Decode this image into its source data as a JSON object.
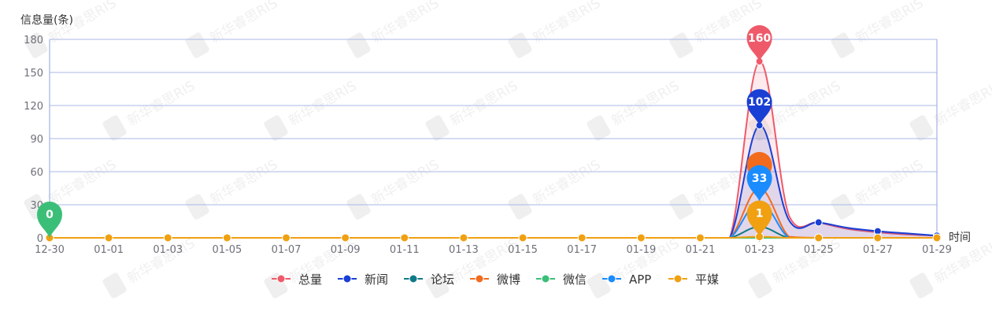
{
  "chart_data": {
    "type": "line",
    "ylabel": "信息量(条)",
    "xlabel": "时间",
    "ylim": [
      0,
      180
    ],
    "yticks": [
      0,
      30,
      60,
      90,
      120,
      150,
      180
    ],
    "categories": [
      "12-30",
      "12-31",
      "01-01",
      "01-02",
      "01-03",
      "01-04",
      "01-05",
      "01-06",
      "01-07",
      "01-08",
      "01-09",
      "01-10",
      "01-11",
      "01-12",
      "01-13",
      "01-14",
      "01-15",
      "01-16",
      "01-17",
      "01-18",
      "01-19",
      "01-20",
      "01-21",
      "01-22",
      "01-23",
      "01-24",
      "01-25",
      "01-26",
      "01-27",
      "01-28",
      "01-29"
    ],
    "x_tick_labels": [
      "12-30",
      "01-01",
      "01-03",
      "01-05",
      "01-07",
      "01-09",
      "01-11",
      "01-13",
      "01-15",
      "01-17",
      "01-19",
      "01-21",
      "01-23",
      "01-25",
      "01-27",
      "01-29"
    ],
    "grid": true,
    "legend_position": "bottom-center",
    "series": [
      {
        "name": "总量",
        "color": "#ee5a6a",
        "values": [
          0,
          0,
          0,
          0,
          0,
          0,
          0,
          0,
          0,
          0,
          0,
          0,
          0,
          0,
          0,
          0,
          0,
          0,
          0,
          0,
          0,
          0,
          0,
          0,
          160,
          20,
          14,
          8,
          5,
          3,
          2
        ],
        "pin": {
          "index": 24,
          "label": "160"
        }
      },
      {
        "name": "新闻",
        "color": "#1a3fd4",
        "values": [
          0,
          0,
          0,
          0,
          0,
          0,
          0,
          0,
          0,
          0,
          0,
          0,
          0,
          0,
          0,
          0,
          0,
          0,
          0,
          0,
          0,
          0,
          0,
          0,
          102,
          16,
          14,
          9,
          6,
          4,
          2
        ],
        "pin": {
          "index": 24,
          "label": "102"
        }
      },
      {
        "name": "论坛",
        "color": "#0f7a87",
        "values": [
          0,
          0,
          0,
          0,
          0,
          0,
          0,
          0,
          0,
          0,
          0,
          0,
          0,
          0,
          0,
          0,
          0,
          0,
          0,
          0,
          0,
          0,
          0,
          0,
          10,
          0,
          0,
          0,
          0,
          0,
          0
        ]
      },
      {
        "name": "微博",
        "color": "#f26b1d",
        "values": [
          0,
          0,
          0,
          0,
          0,
          0,
          0,
          0,
          0,
          0,
          0,
          0,
          0,
          0,
          0,
          0,
          0,
          0,
          0,
          0,
          0,
          0,
          0,
          0,
          45,
          1,
          0,
          0,
          0,
          0,
          0
        ],
        "pin": {
          "index": 24,
          "label": ""
        }
      },
      {
        "name": "微信",
        "color": "#3bbf78",
        "values": [
          0,
          0,
          0,
          0,
          0,
          0,
          0,
          0,
          0,
          0,
          0,
          0,
          0,
          0,
          0,
          0,
          0,
          0,
          0,
          0,
          0,
          0,
          0,
          0,
          0,
          0,
          0,
          0,
          0,
          0,
          0
        ],
        "pin": {
          "index": 0,
          "label": "0"
        }
      },
      {
        "name": "APP",
        "color": "#1a8cff",
        "values": [
          0,
          0,
          0,
          0,
          0,
          0,
          0,
          0,
          0,
          0,
          0,
          0,
          0,
          0,
          0,
          0,
          0,
          0,
          0,
          0,
          0,
          0,
          0,
          0,
          33,
          0,
          0,
          0,
          0,
          0,
          0
        ],
        "pin": {
          "index": 24,
          "label": "33"
        }
      },
      {
        "name": "平媒",
        "color": "#f0a011",
        "values": [
          0,
          0,
          0,
          0,
          0,
          0,
          0,
          0,
          0,
          0,
          0,
          0,
          0,
          0,
          0,
          0,
          0,
          0,
          0,
          0,
          0,
          0,
          0,
          0,
          1,
          0,
          0,
          0,
          0,
          0,
          0
        ],
        "pin": {
          "index": 24,
          "label": "1"
        }
      }
    ]
  },
  "watermark": "新华睿思RIS",
  "colors": {
    "axis": "#8fa3dc",
    "grid": "#aab9e6",
    "tick": "#6e7079",
    "bg": "#ffffff"
  }
}
